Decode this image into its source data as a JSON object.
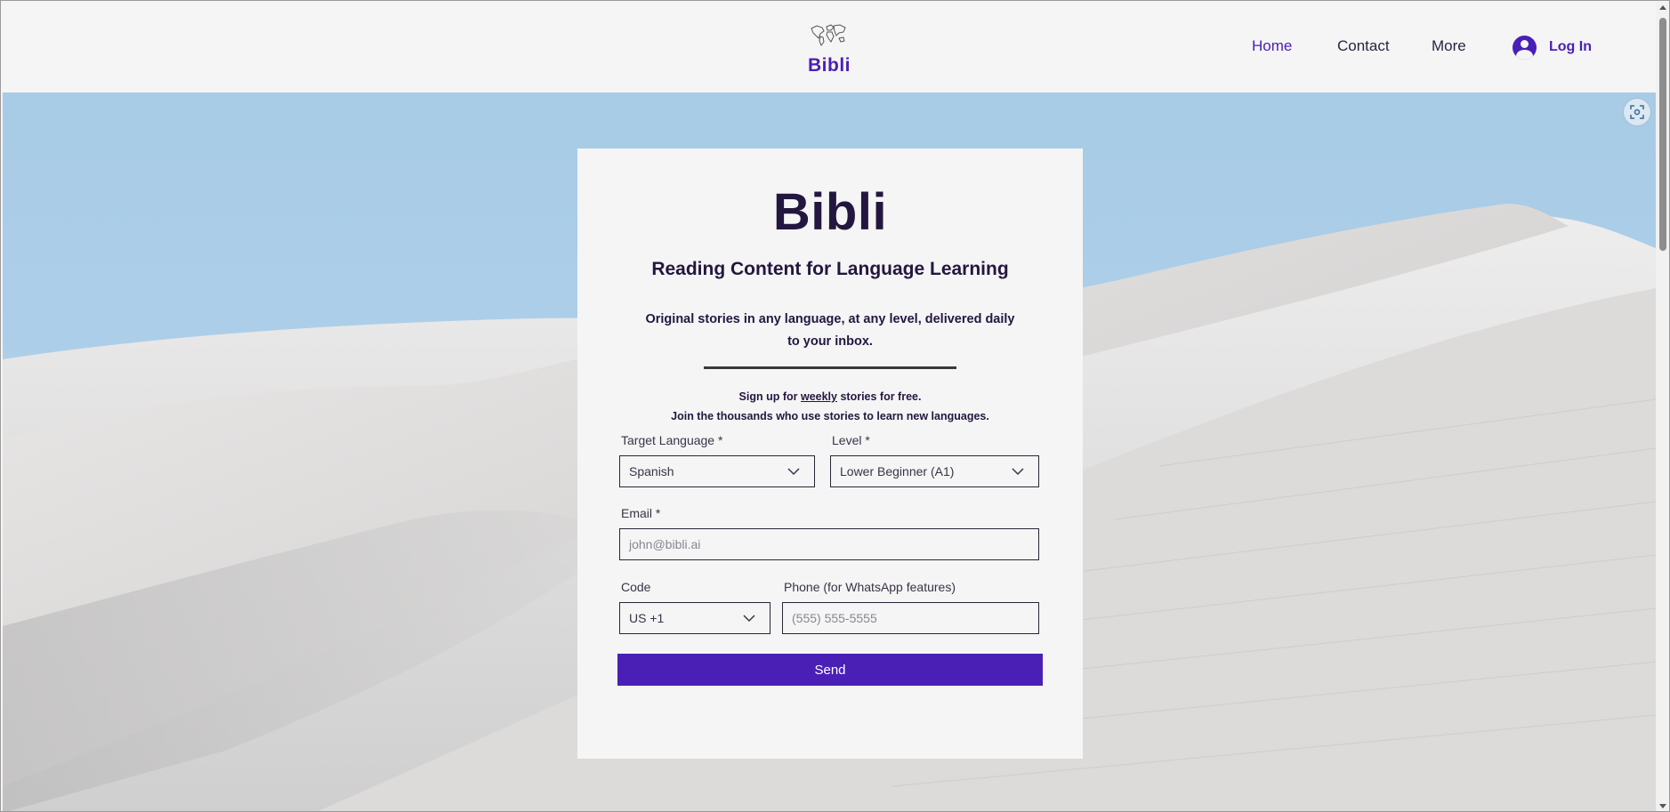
{
  "header": {
    "logo_text": "Bibli",
    "nav": [
      {
        "label": "Home",
        "active": true
      },
      {
        "label": "Contact",
        "active": false
      },
      {
        "label": "More",
        "active": false
      }
    ],
    "login_label": "Log In"
  },
  "hero": {
    "card": {
      "title": "Bibli",
      "subtitle": "Reading Content for Language Learning",
      "tagline": "Original stories in any language, at any level, delivered daily to your inbox.",
      "signup_prefix": "Sign up for ",
      "signup_emphasis": "weekly",
      "signup_suffix": " stories for free.",
      "join_text": "Join the thousands who use stories to learn new languages.",
      "target_language_label": "Target Language *",
      "target_language_value": "Spanish",
      "level_label": "Level *",
      "level_value": "Lower Beginner (A1)",
      "email_label": "Email *",
      "email_placeholder": "john@bibli.ai",
      "code_label": "Code",
      "code_value": "US +1",
      "phone_label": "Phone (for WhatsApp features)",
      "phone_placeholder": "(555) 555-5555",
      "send_label": "Send"
    }
  },
  "colors": {
    "accent": "#4a1fb6",
    "title_text": "#23173f",
    "card_bg": "#f5f5f5",
    "sky": "#a9cbe6"
  },
  "icons": [
    "world-map-icon",
    "avatar-icon",
    "chevron-down-icon",
    "scan-icon"
  ]
}
